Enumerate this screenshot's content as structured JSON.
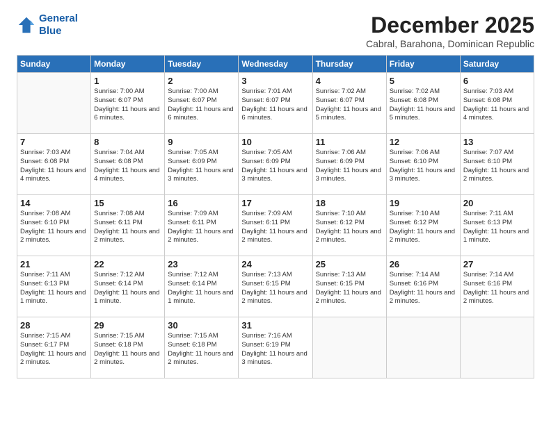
{
  "logo": {
    "line1": "General",
    "line2": "Blue"
  },
  "title": "December 2025",
  "subtitle": "Cabral, Barahona, Dominican Republic",
  "days_header": [
    "Sunday",
    "Monday",
    "Tuesday",
    "Wednesday",
    "Thursday",
    "Friday",
    "Saturday"
  ],
  "weeks": [
    [
      {
        "day": "",
        "info": ""
      },
      {
        "day": "1",
        "info": "Sunrise: 7:00 AM\nSunset: 6:07 PM\nDaylight: 11 hours\nand 6 minutes."
      },
      {
        "day": "2",
        "info": "Sunrise: 7:00 AM\nSunset: 6:07 PM\nDaylight: 11 hours\nand 6 minutes."
      },
      {
        "day": "3",
        "info": "Sunrise: 7:01 AM\nSunset: 6:07 PM\nDaylight: 11 hours\nand 6 minutes."
      },
      {
        "day": "4",
        "info": "Sunrise: 7:02 AM\nSunset: 6:07 PM\nDaylight: 11 hours\nand 5 minutes."
      },
      {
        "day": "5",
        "info": "Sunrise: 7:02 AM\nSunset: 6:08 PM\nDaylight: 11 hours\nand 5 minutes."
      },
      {
        "day": "6",
        "info": "Sunrise: 7:03 AM\nSunset: 6:08 PM\nDaylight: 11 hours\nand 4 minutes."
      }
    ],
    [
      {
        "day": "7",
        "info": "Sunrise: 7:03 AM\nSunset: 6:08 PM\nDaylight: 11 hours\nand 4 minutes."
      },
      {
        "day": "8",
        "info": "Sunrise: 7:04 AM\nSunset: 6:08 PM\nDaylight: 11 hours\nand 4 minutes."
      },
      {
        "day": "9",
        "info": "Sunrise: 7:05 AM\nSunset: 6:09 PM\nDaylight: 11 hours\nand 3 minutes."
      },
      {
        "day": "10",
        "info": "Sunrise: 7:05 AM\nSunset: 6:09 PM\nDaylight: 11 hours\nand 3 minutes."
      },
      {
        "day": "11",
        "info": "Sunrise: 7:06 AM\nSunset: 6:09 PM\nDaylight: 11 hours\nand 3 minutes."
      },
      {
        "day": "12",
        "info": "Sunrise: 7:06 AM\nSunset: 6:10 PM\nDaylight: 11 hours\nand 3 minutes."
      },
      {
        "day": "13",
        "info": "Sunrise: 7:07 AM\nSunset: 6:10 PM\nDaylight: 11 hours\nand 2 minutes."
      }
    ],
    [
      {
        "day": "14",
        "info": "Sunrise: 7:08 AM\nSunset: 6:10 PM\nDaylight: 11 hours\nand 2 minutes."
      },
      {
        "day": "15",
        "info": "Sunrise: 7:08 AM\nSunset: 6:11 PM\nDaylight: 11 hours\nand 2 minutes."
      },
      {
        "day": "16",
        "info": "Sunrise: 7:09 AM\nSunset: 6:11 PM\nDaylight: 11 hours\nand 2 minutes."
      },
      {
        "day": "17",
        "info": "Sunrise: 7:09 AM\nSunset: 6:11 PM\nDaylight: 11 hours\nand 2 minutes."
      },
      {
        "day": "18",
        "info": "Sunrise: 7:10 AM\nSunset: 6:12 PM\nDaylight: 11 hours\nand 2 minutes."
      },
      {
        "day": "19",
        "info": "Sunrise: 7:10 AM\nSunset: 6:12 PM\nDaylight: 11 hours\nand 2 minutes."
      },
      {
        "day": "20",
        "info": "Sunrise: 7:11 AM\nSunset: 6:13 PM\nDaylight: 11 hours\nand 1 minute."
      }
    ],
    [
      {
        "day": "21",
        "info": "Sunrise: 7:11 AM\nSunset: 6:13 PM\nDaylight: 11 hours\nand 1 minute."
      },
      {
        "day": "22",
        "info": "Sunrise: 7:12 AM\nSunset: 6:14 PM\nDaylight: 11 hours\nand 1 minute."
      },
      {
        "day": "23",
        "info": "Sunrise: 7:12 AM\nSunset: 6:14 PM\nDaylight: 11 hours\nand 1 minute."
      },
      {
        "day": "24",
        "info": "Sunrise: 7:13 AM\nSunset: 6:15 PM\nDaylight: 11 hours\nand 2 minutes."
      },
      {
        "day": "25",
        "info": "Sunrise: 7:13 AM\nSunset: 6:15 PM\nDaylight: 11 hours\nand 2 minutes."
      },
      {
        "day": "26",
        "info": "Sunrise: 7:14 AM\nSunset: 6:16 PM\nDaylight: 11 hours\nand 2 minutes."
      },
      {
        "day": "27",
        "info": "Sunrise: 7:14 AM\nSunset: 6:16 PM\nDaylight: 11 hours\nand 2 minutes."
      }
    ],
    [
      {
        "day": "28",
        "info": "Sunrise: 7:15 AM\nSunset: 6:17 PM\nDaylight: 11 hours\nand 2 minutes."
      },
      {
        "day": "29",
        "info": "Sunrise: 7:15 AM\nSunset: 6:18 PM\nDaylight: 11 hours\nand 2 minutes."
      },
      {
        "day": "30",
        "info": "Sunrise: 7:15 AM\nSunset: 6:18 PM\nDaylight: 11 hours\nand 2 minutes."
      },
      {
        "day": "31",
        "info": "Sunrise: 7:16 AM\nSunset: 6:19 PM\nDaylight: 11 hours\nand 3 minutes."
      },
      {
        "day": "",
        "info": ""
      },
      {
        "day": "",
        "info": ""
      },
      {
        "day": "",
        "info": ""
      }
    ]
  ]
}
